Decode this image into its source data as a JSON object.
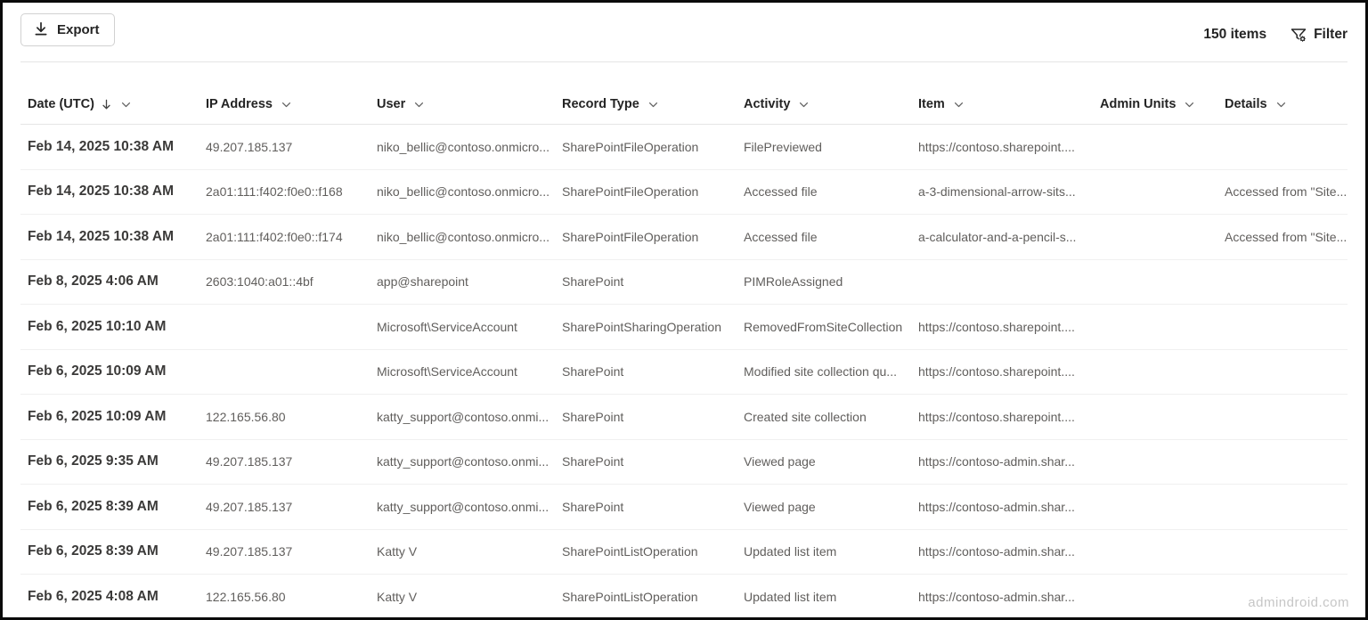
{
  "toolbar": {
    "export_label": "Export",
    "items_count": "150 items",
    "filter_label": "Filter",
    "export_icon": "download-icon",
    "filter_icon": "filter-settings-icon"
  },
  "table": {
    "sort_icon": "arrow-down-icon",
    "menu_icon": "chevron-down-icon",
    "columns": [
      {
        "key": "date",
        "label": "Date (UTC)",
        "sorted": true
      },
      {
        "key": "ip",
        "label": "IP Address",
        "sorted": false
      },
      {
        "key": "user",
        "label": "User",
        "sorted": false
      },
      {
        "key": "recordType",
        "label": "Record Type",
        "sorted": false
      },
      {
        "key": "activity",
        "label": "Activity",
        "sorted": false
      },
      {
        "key": "item",
        "label": "Item",
        "sorted": false
      },
      {
        "key": "adminUnits",
        "label": "Admin Units",
        "sorted": false
      },
      {
        "key": "details",
        "label": "Details",
        "sorted": false
      }
    ],
    "rows": [
      {
        "date": "Feb 14, 2025 10:38 AM",
        "ip": "49.207.185.137",
        "user": "niko_bellic@contoso.onmicro...",
        "recordType": "SharePointFileOperation",
        "activity": "FilePreviewed",
        "item": "https://contoso.sharepoint....",
        "adminUnits": "",
        "details": ""
      },
      {
        "date": "Feb 14, 2025 10:38 AM",
        "ip": "2a01:111:f402:f0e0::f168",
        "user": "niko_bellic@contoso.onmicro...",
        "recordType": "SharePointFileOperation",
        "activity": "Accessed file",
        "item": "a-3-dimensional-arrow-sits...",
        "adminUnits": "",
        "details": "Accessed from \"Site..."
      },
      {
        "date": "Feb 14, 2025 10:38 AM",
        "ip": "2a01:111:f402:f0e0::f174",
        "user": "niko_bellic@contoso.onmicro...",
        "recordType": "SharePointFileOperation",
        "activity": "Accessed file",
        "item": "a-calculator-and-a-pencil-s...",
        "adminUnits": "",
        "details": "Accessed from \"Site..."
      },
      {
        "date": "Feb 8, 2025 4:06 AM",
        "ip": "2603:1040:a01::4bf",
        "user": "app@sharepoint",
        "recordType": "SharePoint",
        "activity": "PIMRoleAssigned",
        "item": "",
        "adminUnits": "",
        "details": ""
      },
      {
        "date": "Feb 6, 2025 10:10 AM",
        "ip": "",
        "user": "Microsoft\\ServiceAccount",
        "recordType": "SharePointSharingOperation",
        "activity": "RemovedFromSiteCollection",
        "item": "https://contoso.sharepoint....",
        "adminUnits": "",
        "details": ""
      },
      {
        "date": "Feb 6, 2025 10:09 AM",
        "ip": "",
        "user": "Microsoft\\ServiceAccount",
        "recordType": "SharePoint",
        "activity": "Modified site collection qu...",
        "item": "https://contoso.sharepoint....",
        "adminUnits": "",
        "details": ""
      },
      {
        "date": "Feb 6, 2025 10:09 AM",
        "ip": "122.165.56.80",
        "user": "katty_support@contoso.onmi...",
        "recordType": "SharePoint",
        "activity": "Created site collection",
        "item": "https://contoso.sharepoint....",
        "adminUnits": "",
        "details": ""
      },
      {
        "date": "Feb 6, 2025 9:35 AM",
        "ip": "49.207.185.137",
        "user": "katty_support@contoso.onmi...",
        "recordType": "SharePoint",
        "activity": "Viewed page",
        "item": "https://contoso-admin.shar...",
        "adminUnits": "",
        "details": ""
      },
      {
        "date": "Feb 6, 2025 8:39 AM",
        "ip": "49.207.185.137",
        "user": "katty_support@contoso.onmi...",
        "recordType": "SharePoint",
        "activity": "Viewed page",
        "item": "https://contoso-admin.shar...",
        "adminUnits": "",
        "details": ""
      },
      {
        "date": "Feb 6, 2025 8:39 AM",
        "ip": "49.207.185.137",
        "user": "Katty V",
        "recordType": "SharePointListOperation",
        "activity": "Updated list item",
        "item": "https://contoso-admin.shar...",
        "adminUnits": "",
        "details": ""
      },
      {
        "date": "Feb 6, 2025 4:08 AM",
        "ip": "122.165.56.80",
        "user": "Katty V",
        "recordType": "SharePointListOperation",
        "activity": "Updated list item",
        "item": "https://contoso-admin.shar...",
        "adminUnits": "",
        "details": ""
      }
    ]
  },
  "watermark": {
    "text": "admindroid.com"
  },
  "colors": {
    "frame_border": "#0a0a0a",
    "background": "#ffffff",
    "header_text": "#242424",
    "date_text": "#3b3a39",
    "cell_text": "#605e5c",
    "divider": "#e5e5e5",
    "row_divider": "#f0f0f0",
    "button_border": "#d1d1d1",
    "watermark_text": "#c6c6c6"
  }
}
